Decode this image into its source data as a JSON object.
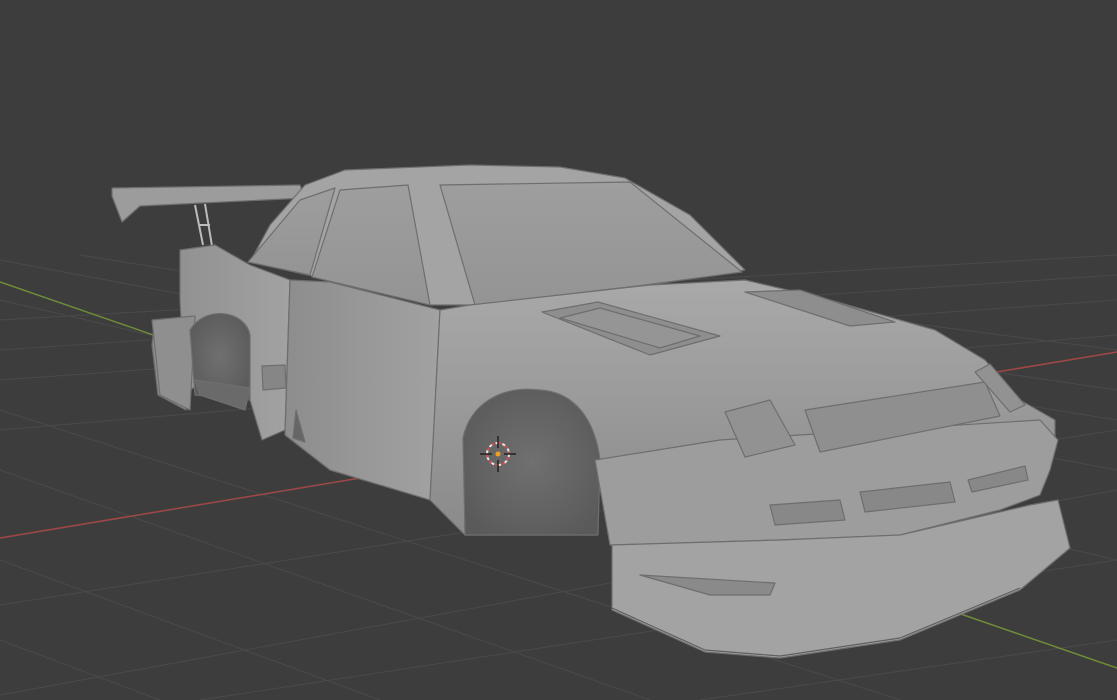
{
  "viewport": {
    "background": "#3d3d3d",
    "grid_color": "#484848",
    "x_axis_color": "#b34a4a",
    "y_axis_color": "#7a9a3c",
    "model_color": "#999999",
    "cursor_colors": [
      "#e8e8e8",
      "#d44a4a"
    ]
  },
  "icons": [
    "3d-cursor-icon"
  ]
}
